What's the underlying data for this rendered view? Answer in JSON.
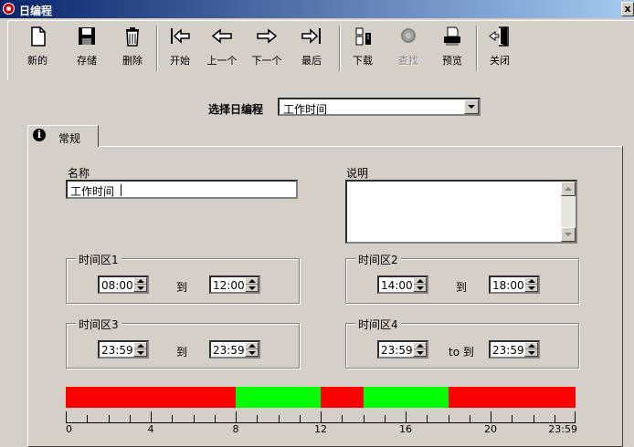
{
  "window": {
    "title": "日编程",
    "close_glyph": "x"
  },
  "toolbar": {
    "items": [
      {
        "label": "新的",
        "icon": "new-file-icon"
      },
      {
        "label": "存储",
        "icon": "save-disk-icon"
      },
      {
        "label": "删除",
        "icon": "trash-icon"
      },
      {
        "label": "开始",
        "icon": "first-arrow-icon"
      },
      {
        "label": "上一个",
        "icon": "prev-arrow-icon"
      },
      {
        "label": "下一个",
        "icon": "next-arrow-icon"
      },
      {
        "label": "最后",
        "icon": "last-arrow-icon"
      },
      {
        "label": "下载",
        "icon": "download-icon"
      },
      {
        "label": "查找",
        "icon": "search-icon",
        "disabled": true
      },
      {
        "label": "预览",
        "icon": "print-preview-icon"
      },
      {
        "label": "关闭",
        "icon": "exit-door-icon"
      }
    ]
  },
  "selector": {
    "label": "选择日编程",
    "value": "工作时间"
  },
  "tab": {
    "label": "常规",
    "icon_glyph": "i"
  },
  "form": {
    "name_label": "名称",
    "name_value": "工作时间",
    "desc_label": "说明",
    "desc_value": ""
  },
  "zones": [
    {
      "title": "时间区1",
      "from": "08:00",
      "sep": "到",
      "to": "12:00"
    },
    {
      "title": "时间区2",
      "from": "14:00",
      "sep": "到",
      "to": "18:00"
    },
    {
      "title": "时间区3",
      "from": "23:59",
      "sep": "到",
      "to": "23:59"
    },
    {
      "title": "时间区4",
      "from": "23:59",
      "sep": "to 到",
      "to": "23:59"
    }
  ],
  "timeline": {
    "colors": {
      "active": "#00ff00",
      "inactive": "#ff0000"
    },
    "segments": [
      {
        "start": 0,
        "end": 8,
        "state": "inactive"
      },
      {
        "start": 8,
        "end": 12,
        "state": "active"
      },
      {
        "start": 12,
        "end": 14,
        "state": "inactive"
      },
      {
        "start": 14,
        "end": 18,
        "state": "active"
      },
      {
        "start": 18,
        "end": 24,
        "state": "inactive"
      }
    ],
    "tick_labels": [
      {
        "hour": 0,
        "text": "0"
      },
      {
        "hour": 4,
        "text": "4"
      },
      {
        "hour": 8,
        "text": "8"
      },
      {
        "hour": 12,
        "text": "12"
      },
      {
        "hour": 16,
        "text": "16"
      },
      {
        "hour": 20,
        "text": "20"
      },
      {
        "hour": 24,
        "text": "23:59"
      }
    ]
  }
}
